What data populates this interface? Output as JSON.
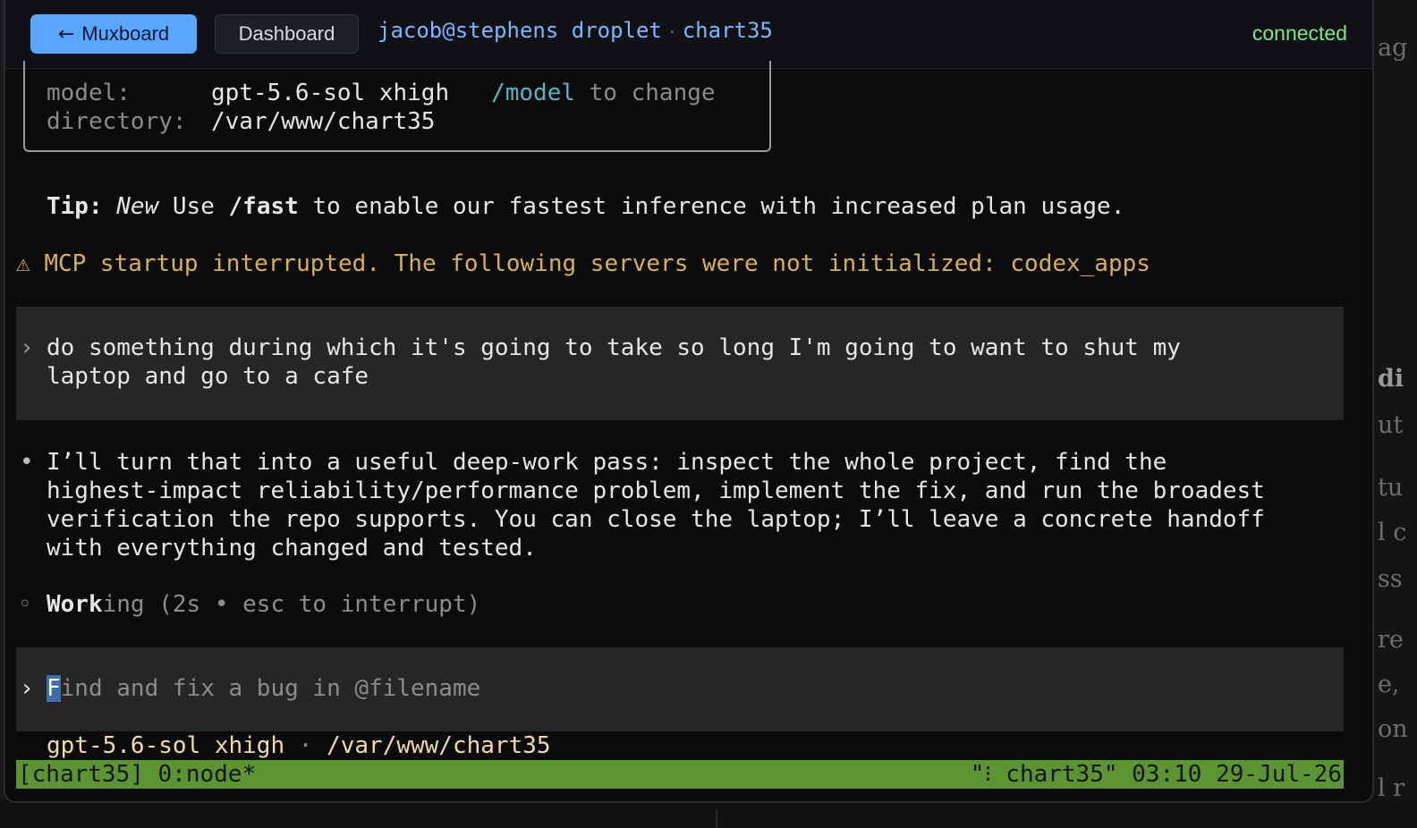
{
  "header": {
    "back_label": "Muxboard",
    "dashboard_label": "Dashboard",
    "session_host": "jacob@stephens droplet",
    "session_sep": "·",
    "session_name": "chart35",
    "status": "connected"
  },
  "terminal": {
    "info": {
      "model_key": "model:",
      "model_value": "gpt-5.6-sol xhigh",
      "model_cmd": "/model",
      "model_hint": "to change",
      "dir_key": "directory:",
      "dir_value": "/var/www/chart35"
    },
    "tip": {
      "label": "Tip:",
      "new": "New",
      "pre": "Use",
      "cmd": "/fast",
      "rest": "to enable our fastest inference with increased plan usage."
    },
    "warning": {
      "icon": "⚠",
      "text": "MCP startup interrupted. The following servers were not initialized: codex_apps"
    },
    "user_message": {
      "line1": "do something during which it's going to take so long I'm going to want to shut my",
      "line2": "laptop and go to a cafe"
    },
    "assistant_message": {
      "line1": "I’ll turn that into a useful deep-work pass: inspect the whole project, find the",
      "line2": "highest-impact reliability/performance problem, implement the fix, and run the broadest",
      "line3": "verification the repo supports. You can close the laptop; I’ll leave a concrete handoff",
      "line4": "with everything changed and tested."
    },
    "working": {
      "bright": "Work",
      "dim": "ing (2s • esc to interrupt)"
    },
    "input": {
      "cursor_char": "F",
      "placeholder_rest": "ind and fix a bug in @filename"
    },
    "footer": {
      "model": "gpt-5.6-sol xhigh",
      "sep": "·",
      "path": "/var/www/chart35"
    }
  },
  "tmux": {
    "left": "[chart35] 0:node*",
    "right": "\"⁝ chart35\" 03:10 29-Jul-26"
  },
  "background_page": {
    "lines": [
      "ag",
      "di",
      "ut",
      "tu",
      "l c",
      "ss",
      "re",
      "e,",
      "on",
      "l r"
    ]
  },
  "colors": {
    "accent": "#58a6ff",
    "connected": "#7ee787",
    "warning": "#d8b24a",
    "tmux_bar": "#5b9431",
    "cyan_cmd": "#56b6c2"
  }
}
